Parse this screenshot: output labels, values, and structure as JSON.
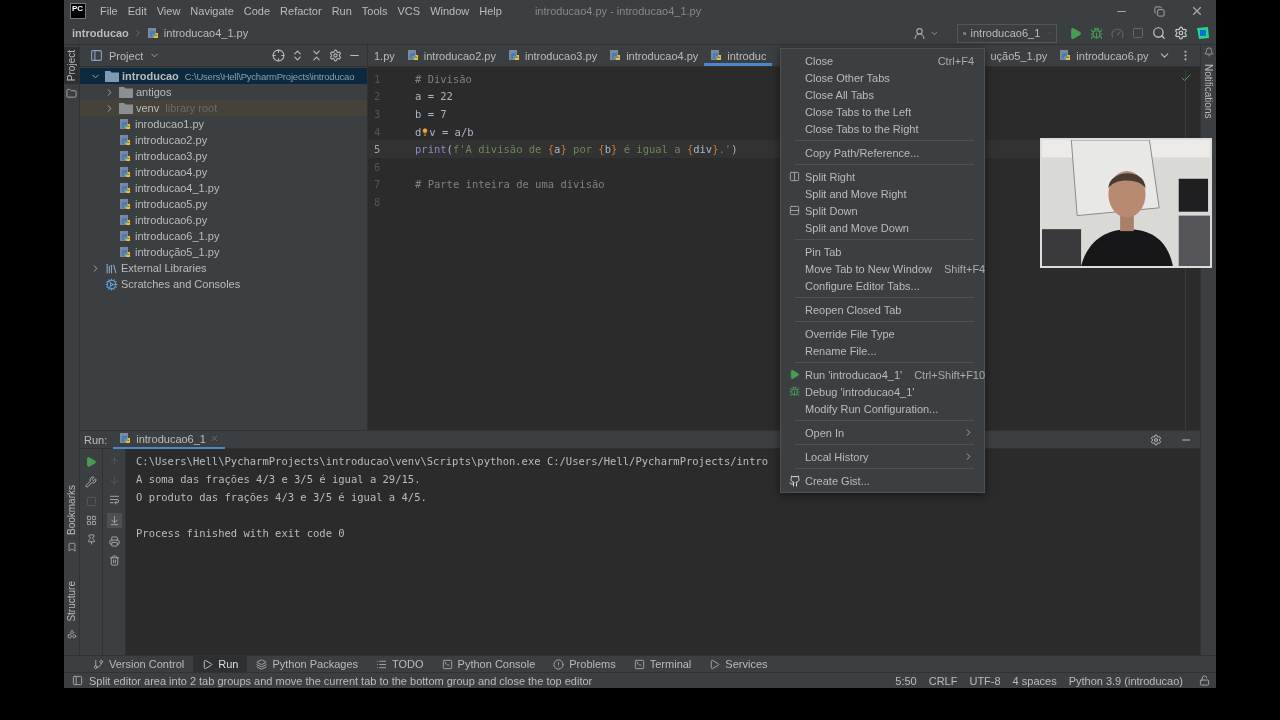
{
  "title_bar": {
    "logo": "PC",
    "menu": [
      "File",
      "Edit",
      "View",
      "Navigate",
      "Code",
      "Refactor",
      "Run",
      "Tools",
      "VCS",
      "Window",
      "Help"
    ],
    "title": "introducao4.py - introducao4_1.py"
  },
  "nav_bar": {
    "breadcrumb": [
      "introducao",
      "introducao4_1.py"
    ],
    "run_config": "introducao6_1"
  },
  "left_stripe": [
    "Project",
    "Bookmarks",
    "Structure"
  ],
  "right_stripe": "Notifications",
  "project_panel": {
    "title": "Project",
    "tree": [
      {
        "kind": "folder",
        "label": "introducao",
        "path": "C:\\Users\\Hell\\PycharmProjects\\introducao",
        "expanded": true,
        "selected": true,
        "children": [
          {
            "kind": "folder",
            "label": "antigos",
            "expanded": false,
            "selected": false
          },
          {
            "kind": "folder",
            "label": "venv",
            "hint": "library root",
            "expanded": false,
            "selected": false
          },
          {
            "kind": "file",
            "label": "inroducao1.py",
            "selected": false
          },
          {
            "kind": "file",
            "label": "introducao2.py",
            "selected": false
          },
          {
            "kind": "file",
            "label": "introducao3.py",
            "selected": false
          },
          {
            "kind": "file",
            "label": "introducao4.py",
            "selected": false
          },
          {
            "kind": "file",
            "label": "introducao4_1.py",
            "selected": false
          },
          {
            "kind": "file",
            "label": "introducao5.py",
            "selected": false
          },
          {
            "kind": "file",
            "label": "introducao6.py",
            "selected": false
          },
          {
            "kind": "file",
            "label": "introducao6_1.py",
            "selected": false
          },
          {
            "kind": "file",
            "label": "introdução5_1.py",
            "selected": false
          }
        ]
      },
      {
        "kind": "library",
        "label": "External Libraries",
        "expanded": false,
        "selected": false
      },
      {
        "kind": "scratches",
        "label": "Scratches and Consoles",
        "selected": false
      }
    ]
  },
  "editor": {
    "tabs": [
      {
        "label": "1.py",
        "selected": false,
        "file_icon": false
      },
      {
        "label": "introducao2.py",
        "selected": false,
        "file_icon": true
      },
      {
        "label": "introducao3.py",
        "selected": false,
        "file_icon": true
      },
      {
        "label": "introducao4.py",
        "selected": false,
        "file_icon": true
      },
      {
        "label": "introduc",
        "selected": true,
        "file_icon": true
      },
      {
        "label": "ução5_1.py",
        "selected": false,
        "file_icon": false
      },
      {
        "label": "introducao6.py",
        "selected": false,
        "file_icon": true
      }
    ],
    "lines": [
      {
        "number": "1",
        "current": false,
        "tokens": [
          {
            "kind": "comment",
            "text": "# Divisão"
          }
        ]
      },
      {
        "number": "2",
        "current": false,
        "tokens": [
          {
            "kind": "plain",
            "text": "a = 22"
          }
        ]
      },
      {
        "number": "3",
        "current": false,
        "tokens": [
          {
            "kind": "plain",
            "text": "b = 7"
          }
        ]
      },
      {
        "number": "4",
        "current": false,
        "tokens": [
          {
            "kind": "plain",
            "text": "d"
          },
          {
            "kind": "bulb"
          },
          {
            "kind": "plain",
            "text": "v = a/b"
          }
        ]
      },
      {
        "number": "5",
        "current": true,
        "tokens": [
          {
            "kind": "builtin",
            "text": "print"
          },
          {
            "kind": "plain",
            "text": "("
          },
          {
            "kind": "string",
            "text": "f'A divisão de "
          },
          {
            "kind": "brace",
            "text": "{"
          },
          {
            "kind": "plain",
            "text": "a"
          },
          {
            "kind": "brace",
            "text": "}"
          },
          {
            "kind": "string",
            "text": " por "
          },
          {
            "kind": "brace",
            "text": "{"
          },
          {
            "kind": "plain",
            "text": "b"
          },
          {
            "kind": "brace",
            "text": "}"
          },
          {
            "kind": "string",
            "text": " é igual a "
          },
          {
            "kind": "brace",
            "text": "{"
          },
          {
            "kind": "plain",
            "text": "div"
          },
          {
            "kind": "brace",
            "text": "}"
          },
          {
            "kind": "string",
            "text": ".'"
          },
          {
            "kind": "plain",
            "text": ")"
          }
        ]
      },
      {
        "number": "6",
        "current": false
      },
      {
        "number": "7",
        "current": false,
        "tokens": [
          {
            "kind": "comment",
            "text": "# Parte inteira de uma divisão"
          }
        ]
      },
      {
        "number": "8",
        "current": false
      }
    ]
  },
  "run_panel": {
    "label": "Run:",
    "tab": "introducao6_1",
    "output": [
      {
        "kind": "command",
        "text": "C:\\Users\\Hell\\PycharmProjects\\introducao\\venv\\Scripts\\python.exe C:/Users/Hell/PycharmProjects/intro"
      },
      {
        "kind": "output",
        "text": "A soma das frações 4/3 e 3/5 é igual a 29/15."
      },
      {
        "kind": "output",
        "text": "O produto das frações 4/3 e 3/5 é igual a 4/5."
      },
      {
        "kind": "exit",
        "text": "Process finished with exit code 0"
      }
    ]
  },
  "tool_windows": [
    {
      "kind": "vcs",
      "label": "Version Control",
      "selected": false
    },
    {
      "kind": "run",
      "label": "Run",
      "selected": true
    },
    {
      "kind": "packages",
      "label": "Python Packages",
      "selected": false
    },
    {
      "kind": "todo",
      "label": "TODO",
      "selected": false
    },
    {
      "kind": "console",
      "label": "Python Console",
      "selected": false
    },
    {
      "kind": "problems",
      "label": "Problems",
      "selected": false
    },
    {
      "kind": "terminal",
      "label": "Terminal",
      "selected": false
    },
    {
      "kind": "services",
      "label": "Services",
      "selected": false
    }
  ],
  "status_bar": {
    "message": "Split editor area into 2 tab groups and move the current tab to the bottom group and close the top editor",
    "items": [
      "5:50",
      "CRLF",
      "UTF-8",
      "4 spaces",
      "Python 3.9 (introducao)"
    ]
  },
  "context_menu": {
    "groups": [
      [
        {
          "kind": "plain",
          "label": "Close",
          "shortcut": "Ctrl+F4"
        },
        {
          "kind": "plain",
          "label": "Close Other Tabs"
        },
        {
          "kind": "plain",
          "label": "Close All Tabs"
        },
        {
          "kind": "plain",
          "label": "Close Tabs to the Left"
        },
        {
          "kind": "plain",
          "label": "Close Tabs to the Right"
        }
      ],
      [
        {
          "kind": "plain",
          "label": "Copy Path/Reference..."
        }
      ],
      [
        {
          "kind": "split-right",
          "label": "Split Right"
        },
        {
          "kind": "plain",
          "label": "Split and Move Right"
        },
        {
          "kind": "split-down",
          "label": "Split Down"
        },
        {
          "kind": "plain",
          "label": "Split and Move Down"
        }
      ],
      [
        {
          "kind": "plain",
          "label": "Pin Tab"
        },
        {
          "kind": "plain",
          "label": "Move Tab to New Window",
          "shortcut": "Shift+F4"
        },
        {
          "kind": "plain",
          "label": "Configure Editor Tabs..."
        }
      ],
      [
        {
          "kind": "plain",
          "label": "Reopen Closed Tab"
        }
      ],
      [
        {
          "kind": "plain",
          "label": "Override File Type"
        },
        {
          "kind": "plain",
          "label": "Rename File..."
        }
      ],
      [
        {
          "kind": "run",
          "label": "Run 'introducao4_1'",
          "shortcut": "Ctrl+Shift+F10"
        },
        {
          "kind": "debug",
          "label": "Debug 'introducao4_1'"
        },
        {
          "kind": "plain",
          "label": "Modify Run Configuration..."
        }
      ],
      [
        {
          "kind": "submenu",
          "label": "Open In"
        }
      ],
      [
        {
          "kind": "submenu",
          "label": "Local History"
        }
      ],
      [
        {
          "kind": "github",
          "label": "Create Gist..."
        }
      ]
    ]
  },
  "webcam": {
    "kind": "picture"
  }
}
